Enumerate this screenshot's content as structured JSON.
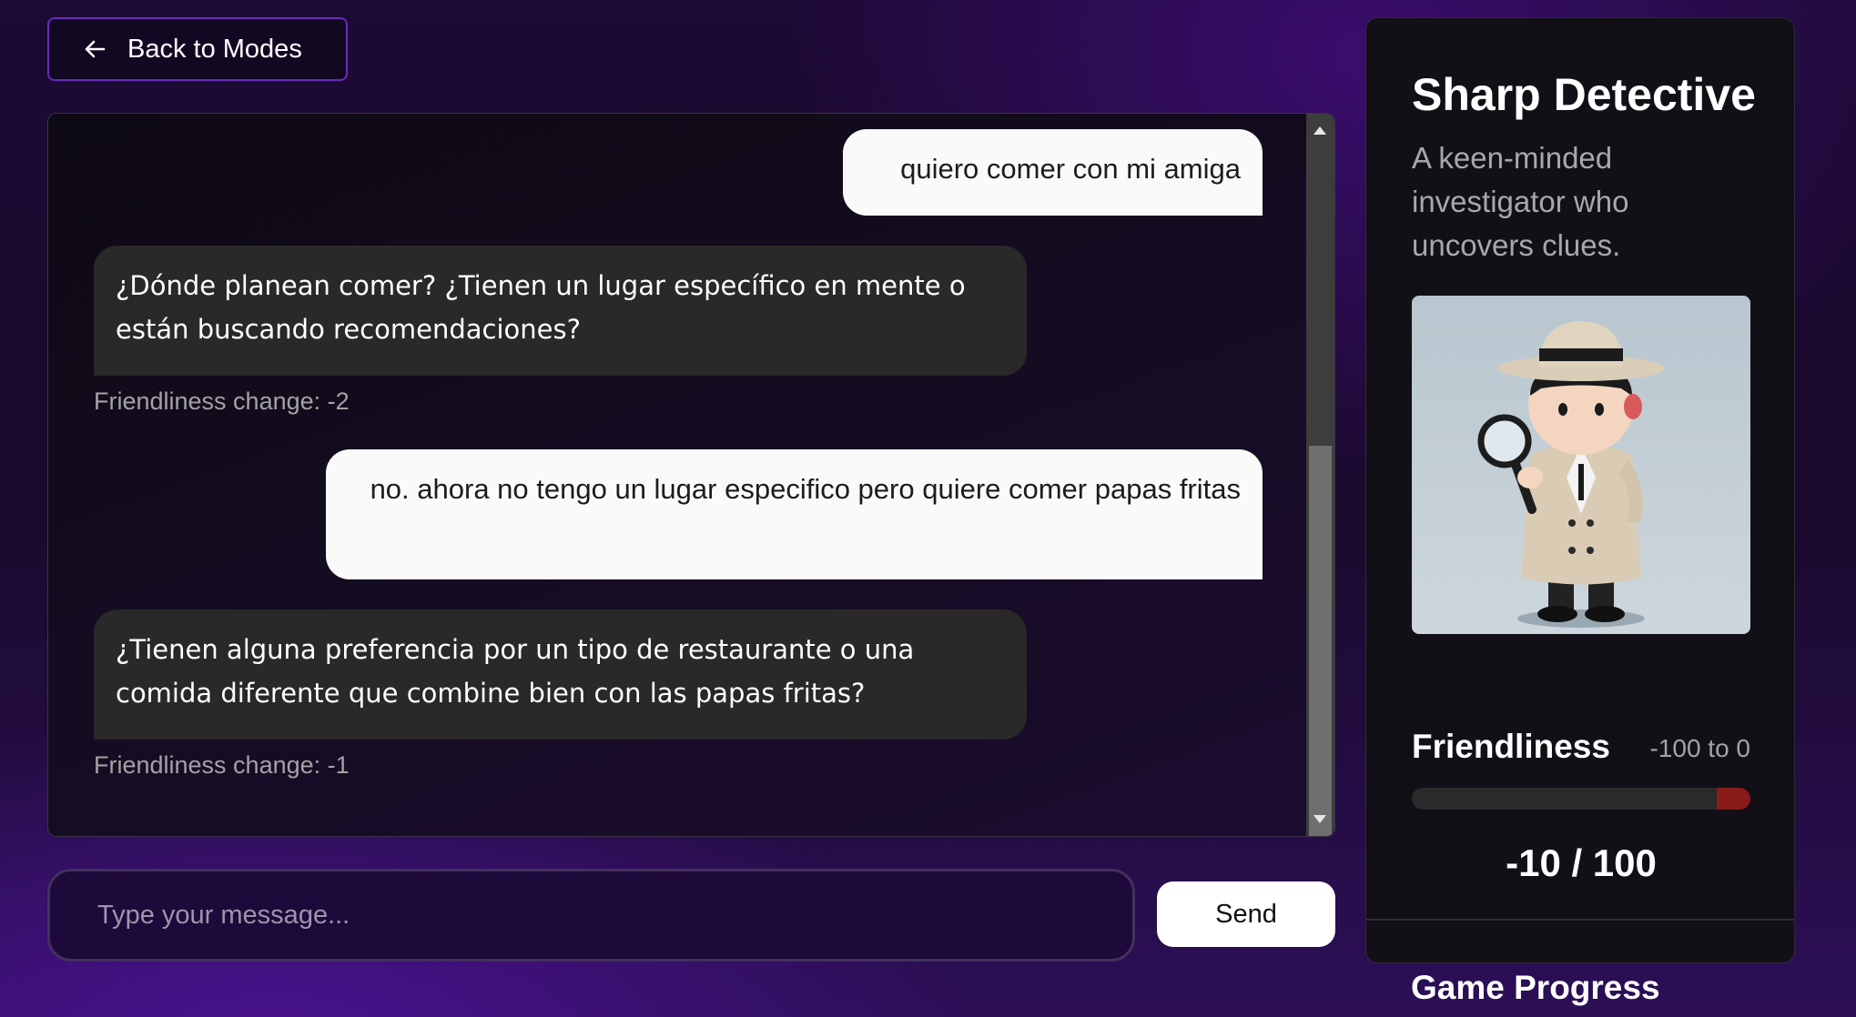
{
  "nav": {
    "back_label": "Back to Modes"
  },
  "messages": [
    {
      "role": "user",
      "text": "quiero comer con mi amiga"
    },
    {
      "role": "bot",
      "text": "¿Dónde planean comer? ¿Tienen un lugar específico en mente o están buscando recomendaciones?",
      "friendliness_change": "Friendliness change: -2"
    },
    {
      "role": "user",
      "text": "no. ahora no tengo un lugar especifico pero quiere comer papas fritas"
    },
    {
      "role": "bot",
      "text": "¿Tienen alguna preferencia por un tipo de restaurante o una comida diferente que combine bien con las papas fritas?",
      "friendliness_change": "Friendliness change: -1"
    }
  ],
  "composer": {
    "placeholder": "Type your message...",
    "send_label": "Send"
  },
  "character": {
    "name": "Sharp Detective",
    "description": "A keen-minded investigator who uncovers clues."
  },
  "friendliness": {
    "label": "Friendliness",
    "range": "-100 to 0",
    "value_display": "-10 / 100",
    "fill_fraction": 0.1,
    "bar_color": "#8b1a1a"
  },
  "game_progress": {
    "title": "Game Progress"
  }
}
